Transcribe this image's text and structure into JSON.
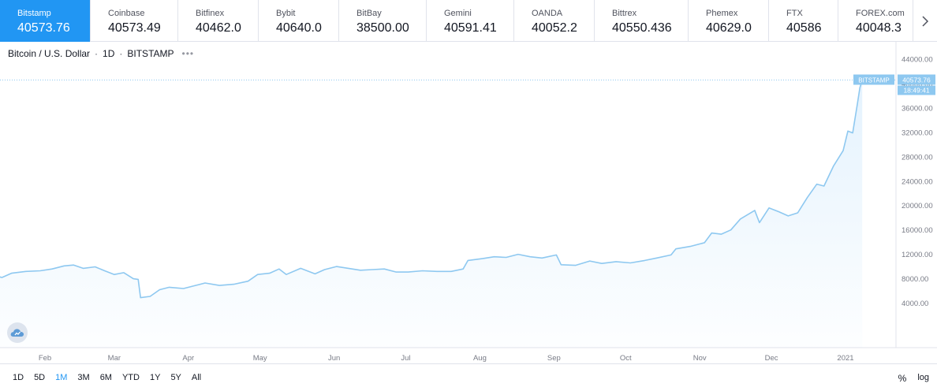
{
  "tickers": [
    {
      "name": "Bitstamp",
      "price": "40573.76",
      "active": true
    },
    {
      "name": "Coinbase",
      "price": "40573.49"
    },
    {
      "name": "Bitfinex",
      "price": "40462.0"
    },
    {
      "name": "Bybit",
      "price": "40640.0"
    },
    {
      "name": "BitBay",
      "price": "38500.00"
    },
    {
      "name": "Gemini",
      "price": "40591.41"
    },
    {
      "name": "OANDA",
      "price": "40052.2"
    },
    {
      "name": "Bittrex",
      "price": "40550.436"
    },
    {
      "name": "Phemex",
      "price": "40629.0"
    },
    {
      "name": "FTX",
      "price": "40586"
    },
    {
      "name": "FOREX.com",
      "price": "40048.3"
    }
  ],
  "legend": {
    "symbol": "Bitcoin / U.S. Dollar",
    "interval": "1D",
    "exchange": "BITSTAMP"
  },
  "price_badge": {
    "exchange": "BITSTAMP",
    "price": "40573.76",
    "countdown": "18:49:41"
  },
  "chart_data": {
    "type": "area",
    "title": "Bitcoin / U.S. Dollar",
    "xlabel": "",
    "ylabel": "",
    "ylim": [
      0,
      45500
    ],
    "grid": false,
    "y_ticks": [
      4000,
      8000,
      12000,
      16000,
      20000,
      24000,
      28000,
      32000,
      36000,
      40000,
      44000
    ],
    "y_tick_labels": [
      "4000.00",
      "8000.00",
      "12000.00",
      "16000.00",
      "20000.00",
      "24000.00",
      "28000.00",
      "32000.00",
      "36000.00",
      "40000.00",
      "44000.00"
    ],
    "x_ticks": [
      {
        "label": "Feb",
        "date": "2020-02-01"
      },
      {
        "label": "Mar",
        "date": "2020-03-01"
      },
      {
        "label": "Apr",
        "date": "2020-04-01"
      },
      {
        "label": "May",
        "date": "2020-05-01"
      },
      {
        "label": "Jun",
        "date": "2020-06-01"
      },
      {
        "label": "Jul",
        "date": "2020-07-01"
      },
      {
        "label": "Aug",
        "date": "2020-08-01"
      },
      {
        "label": "Sep",
        "date": "2020-09-01"
      },
      {
        "label": "Oct",
        "date": "2020-10-01"
      },
      {
        "label": "Nov",
        "date": "2020-11-01"
      },
      {
        "label": "Dec",
        "date": "2020-12-01"
      },
      {
        "label": "2021",
        "date": "2021-01-01"
      }
    ],
    "last_price_label": "40573.76",
    "series": [
      {
        "color": "#8ec8f0",
        "points": [
          [
            "2020-01-05",
            8800
          ],
          [
            "2020-01-10",
            8600
          ],
          [
            "2020-01-14",
            8200
          ],
          [
            "2020-01-18",
            8900
          ],
          [
            "2020-01-24",
            9200
          ],
          [
            "2020-01-30",
            9300
          ],
          [
            "2020-02-04",
            9600
          ],
          [
            "2020-02-09",
            10100
          ],
          [
            "2020-02-13",
            10250
          ],
          [
            "2020-02-17",
            9700
          ],
          [
            "2020-02-22",
            9950
          ],
          [
            "2020-02-26",
            9300
          ],
          [
            "2020-03-01",
            8700
          ],
          [
            "2020-03-05",
            9000
          ],
          [
            "2020-03-09",
            8000
          ],
          [
            "2020-03-11",
            7900
          ],
          [
            "2020-03-12",
            4900
          ],
          [
            "2020-03-16",
            5100
          ],
          [
            "2020-03-20",
            6200
          ],
          [
            "2020-03-24",
            6600
          ],
          [
            "2020-03-30",
            6400
          ],
          [
            "2020-04-03",
            6800
          ],
          [
            "2020-04-08",
            7300
          ],
          [
            "2020-04-14",
            6900
          ],
          [
            "2020-04-20",
            7100
          ],
          [
            "2020-04-26",
            7600
          ],
          [
            "2020-04-30",
            8700
          ],
          [
            "2020-05-05",
            8900
          ],
          [
            "2020-05-09",
            9600
          ],
          [
            "2020-05-12",
            8700
          ],
          [
            "2020-05-18",
            9700
          ],
          [
            "2020-05-24",
            8800
          ],
          [
            "2020-05-28",
            9500
          ],
          [
            "2020-06-02",
            10000
          ],
          [
            "2020-06-07",
            9700
          ],
          [
            "2020-06-12",
            9400
          ],
          [
            "2020-06-17",
            9500
          ],
          [
            "2020-06-22",
            9600
          ],
          [
            "2020-06-27",
            9100
          ],
          [
            "2020-07-02",
            9100
          ],
          [
            "2020-07-08",
            9300
          ],
          [
            "2020-07-14",
            9200
          ],
          [
            "2020-07-20",
            9200
          ],
          [
            "2020-07-25",
            9600
          ],
          [
            "2020-07-27",
            11000
          ],
          [
            "2020-08-02",
            11300
          ],
          [
            "2020-08-07",
            11600
          ],
          [
            "2020-08-12",
            11500
          ],
          [
            "2020-08-17",
            12000
          ],
          [
            "2020-08-22",
            11600
          ],
          [
            "2020-08-27",
            11400
          ],
          [
            "2020-09-02",
            11900
          ],
          [
            "2020-09-04",
            10300
          ],
          [
            "2020-09-10",
            10200
          ],
          [
            "2020-09-16",
            10900
          ],
          [
            "2020-09-21",
            10500
          ],
          [
            "2020-09-27",
            10800
          ],
          [
            "2020-10-03",
            10600
          ],
          [
            "2020-10-09",
            11000
          ],
          [
            "2020-10-14",
            11400
          ],
          [
            "2020-10-20",
            11900
          ],
          [
            "2020-10-22",
            12900
          ],
          [
            "2020-10-28",
            13300
          ],
          [
            "2020-11-03",
            13900
          ],
          [
            "2020-11-06",
            15500
          ],
          [
            "2020-11-10",
            15300
          ],
          [
            "2020-11-14",
            16000
          ],
          [
            "2020-11-18",
            17800
          ],
          [
            "2020-11-24",
            19200
          ],
          [
            "2020-11-26",
            17200
          ],
          [
            "2020-11-30",
            19600
          ],
          [
            "2020-12-04",
            19000
          ],
          [
            "2020-12-08",
            18300
          ],
          [
            "2020-12-12",
            18800
          ],
          [
            "2020-12-16",
            21300
          ],
          [
            "2020-12-20",
            23500
          ],
          [
            "2020-12-23",
            23200
          ],
          [
            "2020-12-27",
            26500
          ],
          [
            "2020-12-31",
            29000
          ],
          [
            "2021-01-02",
            32200
          ],
          [
            "2021-01-04",
            31900
          ],
          [
            "2021-01-06",
            36700
          ],
          [
            "2021-01-07",
            39300
          ],
          [
            "2021-01-08",
            40574
          ]
        ]
      }
    ]
  },
  "ranges": [
    "1D",
    "5D",
    "1M",
    "3M",
    "6M",
    "YTD",
    "1Y",
    "5Y",
    "All"
  ],
  "active_range": "1M",
  "scale_buttons": {
    "percent": "%",
    "log": "log"
  }
}
